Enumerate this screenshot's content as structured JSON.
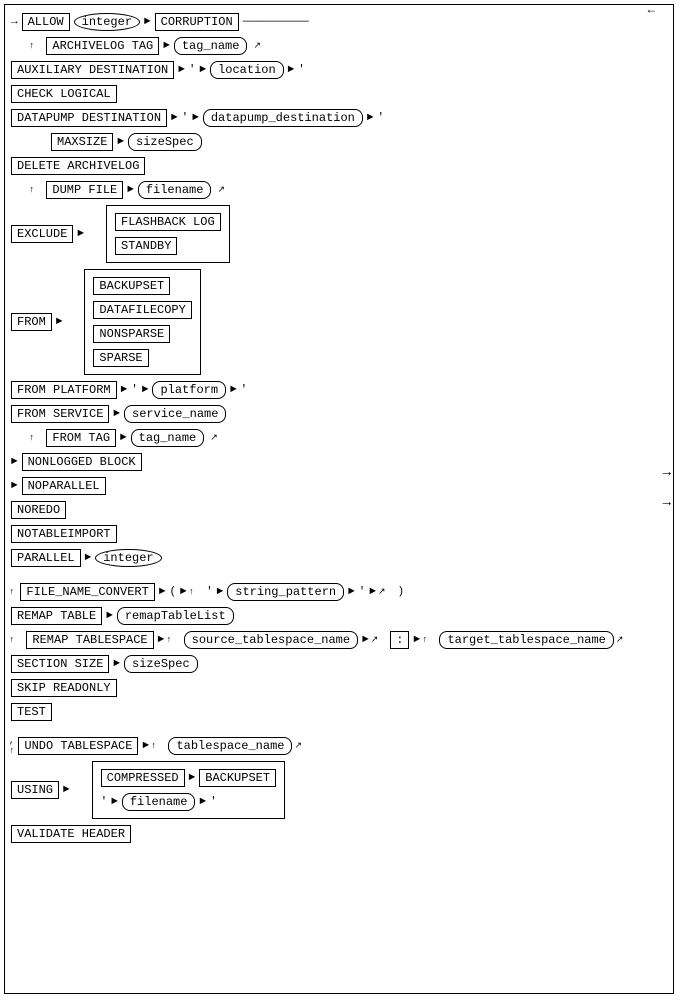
{
  "labels": {
    "allow": "ALLOW",
    "integer": "integer",
    "corruption": "CORRUPTION",
    "archivelog_tag": "ARCHIVELOG TAG",
    "tag_name": "tag_name",
    "auxiliary_destination": "AUXILIARY DESTINATION",
    "location": "location",
    "check_logical": "CHECK LOGICAL",
    "datapump_destination": "DATAPUMP DESTINATION",
    "datapump_dest_val": "datapump_destination",
    "maxsize": "MAXSIZE",
    "sizespec": "sizeSpec",
    "delete_archivelog": "DELETE ARCHIVELOG",
    "dump_file": "DUMP FILE",
    "filename": "filename",
    "exclude": "EXCLUDE",
    "flashback_log": "FLASHBACK LOG",
    "standby": "STANDBY",
    "from": "FROM",
    "backupset": "BACKUPSET",
    "datafilecopy": "DATAFILECOPY",
    "nonsparse": "NONSPARSE",
    "sparse": "SPARSE",
    "from_platform": "FROM PLATFORM",
    "platform": "platform",
    "from_service": "FROM SERVICE",
    "service_name": "service_name",
    "from_tag": "FROM TAG",
    "nonlogged_block": "NONLOGGED BLOCK",
    "noparallel": "NOPARALLEL",
    "noredo": "NOREDO",
    "notableimport": "NOTABLEIMPORT",
    "parallel": "PARALLEL",
    "file_name_convert": "FILE_NAME_CONVERT",
    "string_pattern": "string_pattern",
    "remap_table": "REMAP TABLE",
    "remap_table_list": "remapTableList",
    "remap_tablespace": "REMAP TABLESPACE",
    "source_tablespace": "source_tablespace_name",
    "colon": ":",
    "target_tablespace": "target_tablespace_name",
    "section_size": "SECTION SIZE",
    "skip_readonly": "SKIP READONLY",
    "test": "TEST",
    "undo_tablespace": "UNDO TABLESPACE",
    "tablespace_name": "tablespace_name",
    "compressed": "COMPRESSED",
    "using": "USING",
    "backupset2": "BACKUPSET",
    "validate_header": "VALIDATE HEADER"
  }
}
